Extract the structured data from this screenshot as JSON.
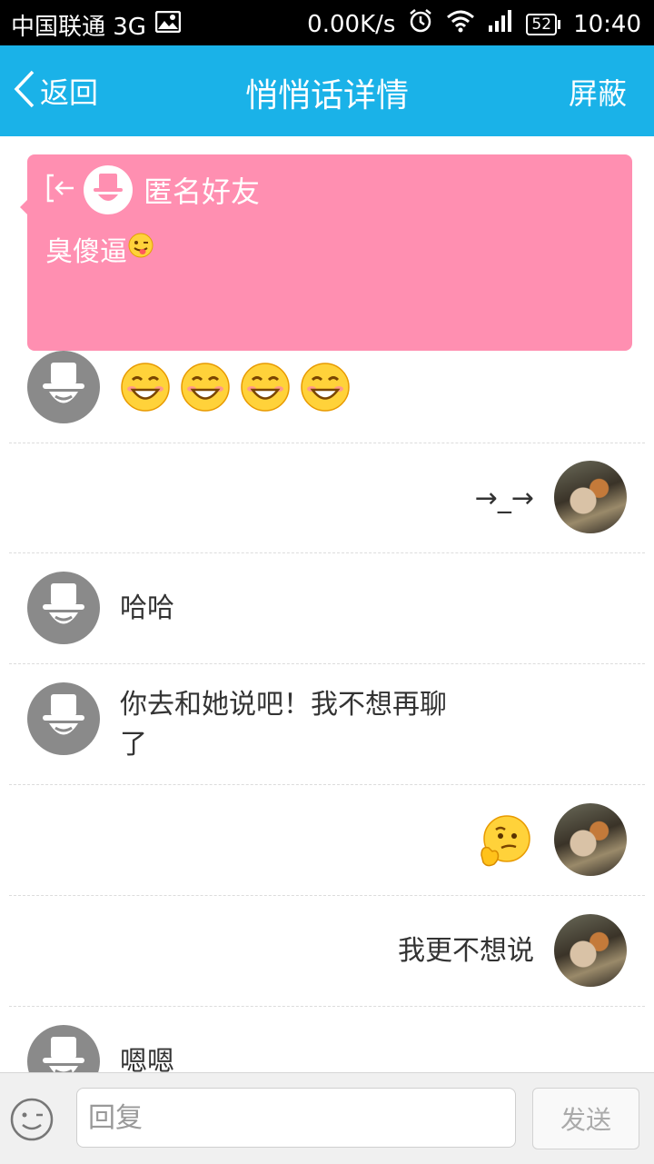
{
  "status_bar": {
    "carrier": "中国联通 3G",
    "speed": "0.00K/s",
    "battery": "52",
    "time": "10:40"
  },
  "header": {
    "back_label": "返回",
    "title": "悄悄话详情",
    "block_label": "屏蔽",
    "color": "#1ab2e8"
  },
  "post": {
    "author": "匿名好友",
    "content": "臭傻逼",
    "emoji": "tongue-wink-emoji",
    "color": "#ff8fb1"
  },
  "messages": [
    {
      "side": "left",
      "avatar": "anonymous",
      "emoji": [
        "grin-emoji",
        "grin-emoji",
        "grin-emoji",
        "grin-emoji"
      ]
    },
    {
      "side": "right",
      "avatar": "photo",
      "text": "→_→"
    },
    {
      "side": "left",
      "avatar": "anonymous",
      "text": "哈哈"
    },
    {
      "side": "left",
      "avatar": "anonymous",
      "text_line1": "你去和她说吧！我不想再聊",
      "text_line2": "了"
    },
    {
      "side": "right",
      "avatar": "photo",
      "emoji": [
        "thinking-emoji"
      ]
    },
    {
      "side": "right",
      "avatar": "photo",
      "text": "我更不想说"
    },
    {
      "side": "left",
      "avatar": "anonymous",
      "text": "嗯嗯"
    }
  ],
  "composer": {
    "placeholder": "回复",
    "send_label": "发送"
  }
}
